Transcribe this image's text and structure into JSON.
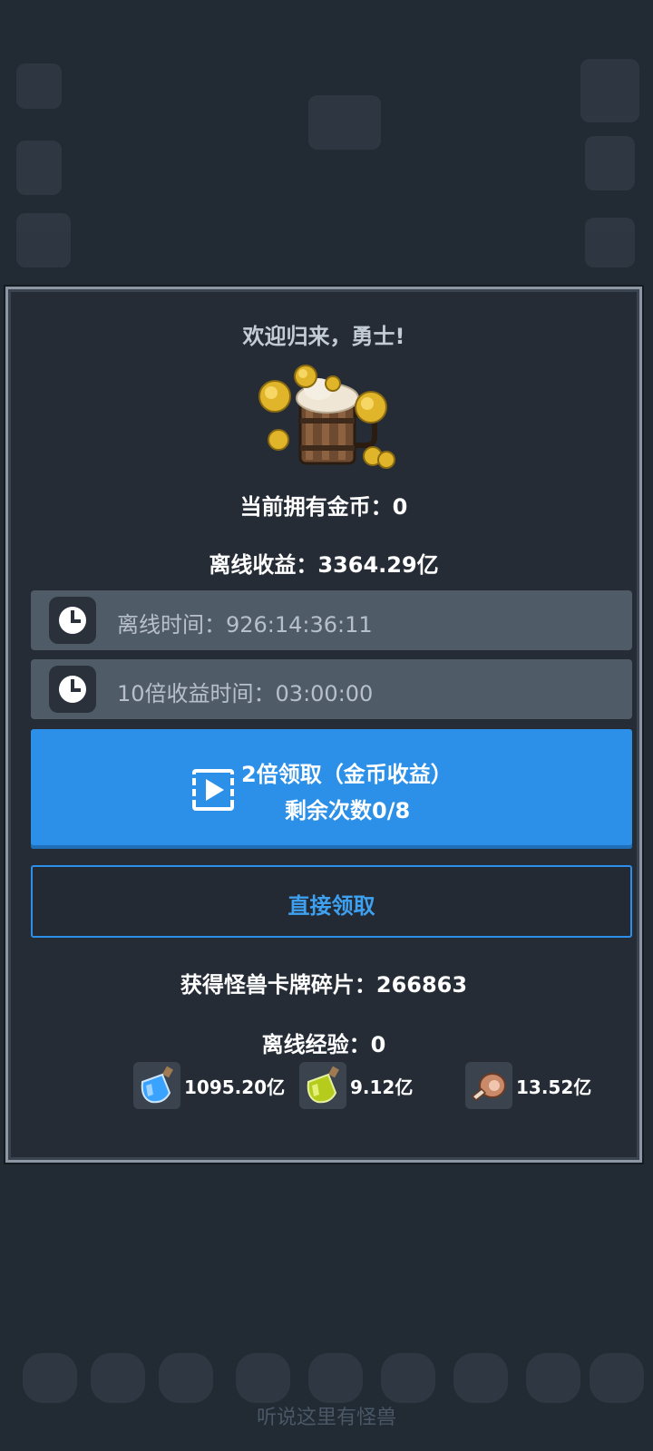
{
  "background": {
    "footer_text": "听说这里有怪兽"
  },
  "dialog": {
    "title": "欢迎归来，勇士!",
    "current_gold_label": "当前拥有金币：0",
    "offline_income_label": "离线收益：3364.29亿",
    "offline_time_label": "离线时间：926:14:36:11",
    "ten_x_time_label": "10倍收益时间：03:00:00",
    "video_button": {
      "line1": "2倍领取（金币收益）",
      "line2": "剩余次数0/8"
    },
    "claim_button_label": "直接领取",
    "card_shards_label": "获得怪兽卡牌碎片：266863",
    "offline_exp_label": "离线经验：0",
    "resources": [
      {
        "icon": "blue-potion-icon",
        "value": "1095.20亿"
      },
      {
        "icon": "green-potion-icon",
        "value": "9.12亿"
      },
      {
        "icon": "meat-icon",
        "value": "13.52亿"
      }
    ]
  },
  "colors": {
    "accent_blue": "#2c90e8",
    "dialog_bg": "#252c36",
    "row_bg": "#505b68"
  }
}
